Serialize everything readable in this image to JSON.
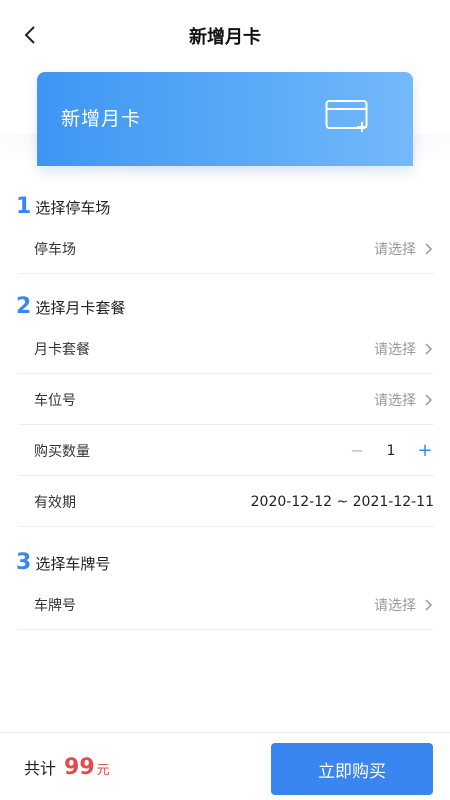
{
  "header": {
    "title": "新增月卡"
  },
  "hero": {
    "title": "新增月卡"
  },
  "sections": [
    {
      "number": "1",
      "title": "选择停车场",
      "rows": [
        {
          "label": "停车场",
          "value": "请选择"
        }
      ]
    },
    {
      "number": "2",
      "title": "选择月卡套餐",
      "rows": [
        {
          "label": "月卡套餐",
          "value": "请选择"
        },
        {
          "label": "车位号",
          "value": "请选择"
        },
        {
          "label": "购买数量",
          "quantity": "1",
          "minus": "−",
          "plus": "+"
        },
        {
          "label": "有效期",
          "value": "2020-12-12 ~ 2021-12-11"
        }
      ]
    },
    {
      "number": "3",
      "title": "选择车牌号",
      "rows": [
        {
          "label": "车牌号",
          "value": "请选择"
        }
      ]
    }
  ],
  "footer": {
    "total_label": "共计",
    "total_amount": "99",
    "total_unit": "元",
    "buy_label": "立即购买"
  },
  "colors": {
    "accent": "#3a86f0",
    "price": "#e5484d",
    "hero_start": "#3e96f4",
    "hero_end": "#74b9fa"
  },
  "icons": {
    "back": "chevron-left-icon",
    "card": "card-add-icon",
    "row_chevron": "chevron-right-icon"
  }
}
